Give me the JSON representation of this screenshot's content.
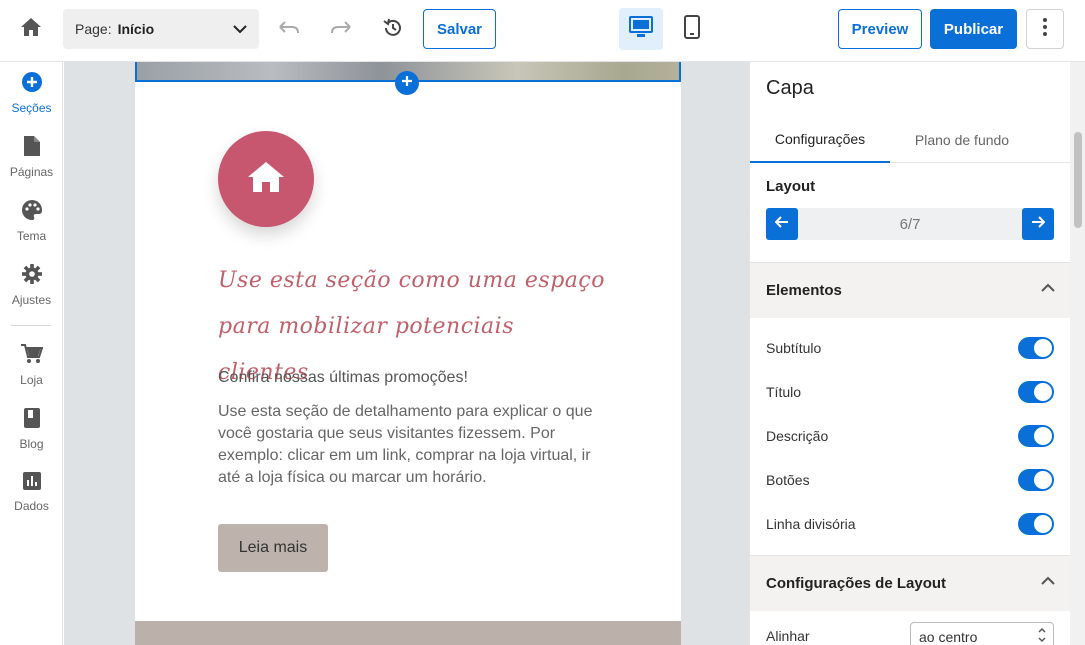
{
  "topbar": {
    "page_prefix": "Page:",
    "page_value": "Início",
    "save_label": "Salvar",
    "preview_label": "Preview",
    "publish_label": "Publicar"
  },
  "sidebar": {
    "items": [
      {
        "label": "Seções",
        "icon": "plus-circle-icon"
      },
      {
        "label": "Páginas",
        "icon": "document-icon"
      },
      {
        "label": "Tema",
        "icon": "palette-icon"
      },
      {
        "label": "Ajustes",
        "icon": "gear-icon"
      },
      {
        "label": "Loja",
        "icon": "cart-icon"
      },
      {
        "label": "Blog",
        "icon": "book-icon"
      },
      {
        "label": "Dados",
        "icon": "chart-icon"
      }
    ]
  },
  "canvas": {
    "title": "Use esta seção como uma espaço para mobilizar potenciais clientes",
    "subtitle": "Confira nossas últimas promoções!",
    "description": "Use esta seção de detalhamento para explicar o que você gostaria que seus visitantes fizessem. Por exemplo: clicar em um link, comprar na loja virtual, ir até a loja física ou marcar um horário.",
    "cta_label": "Leia mais"
  },
  "panel": {
    "title": "Capa",
    "tabs": [
      "Configurações",
      "Plano de fundo"
    ],
    "layout_label": "Layout",
    "layout_value": "6/7",
    "elements_header": "Elementos",
    "toggles": [
      {
        "label": "Subtítulo",
        "on": true
      },
      {
        "label": "Título",
        "on": true
      },
      {
        "label": "Descrição",
        "on": true
      },
      {
        "label": "Botões",
        "on": true
      },
      {
        "label": "Linha divisória",
        "on": true
      }
    ],
    "layout_settings_header": "Configurações de Layout",
    "align_label": "Alinhar",
    "align_value": "ao centro"
  },
  "colors": {
    "accent": "#0b6fd8",
    "icon_circle": "#c7566f",
    "script_title": "#c0606a",
    "cta_bg": "#bdb3ac"
  }
}
